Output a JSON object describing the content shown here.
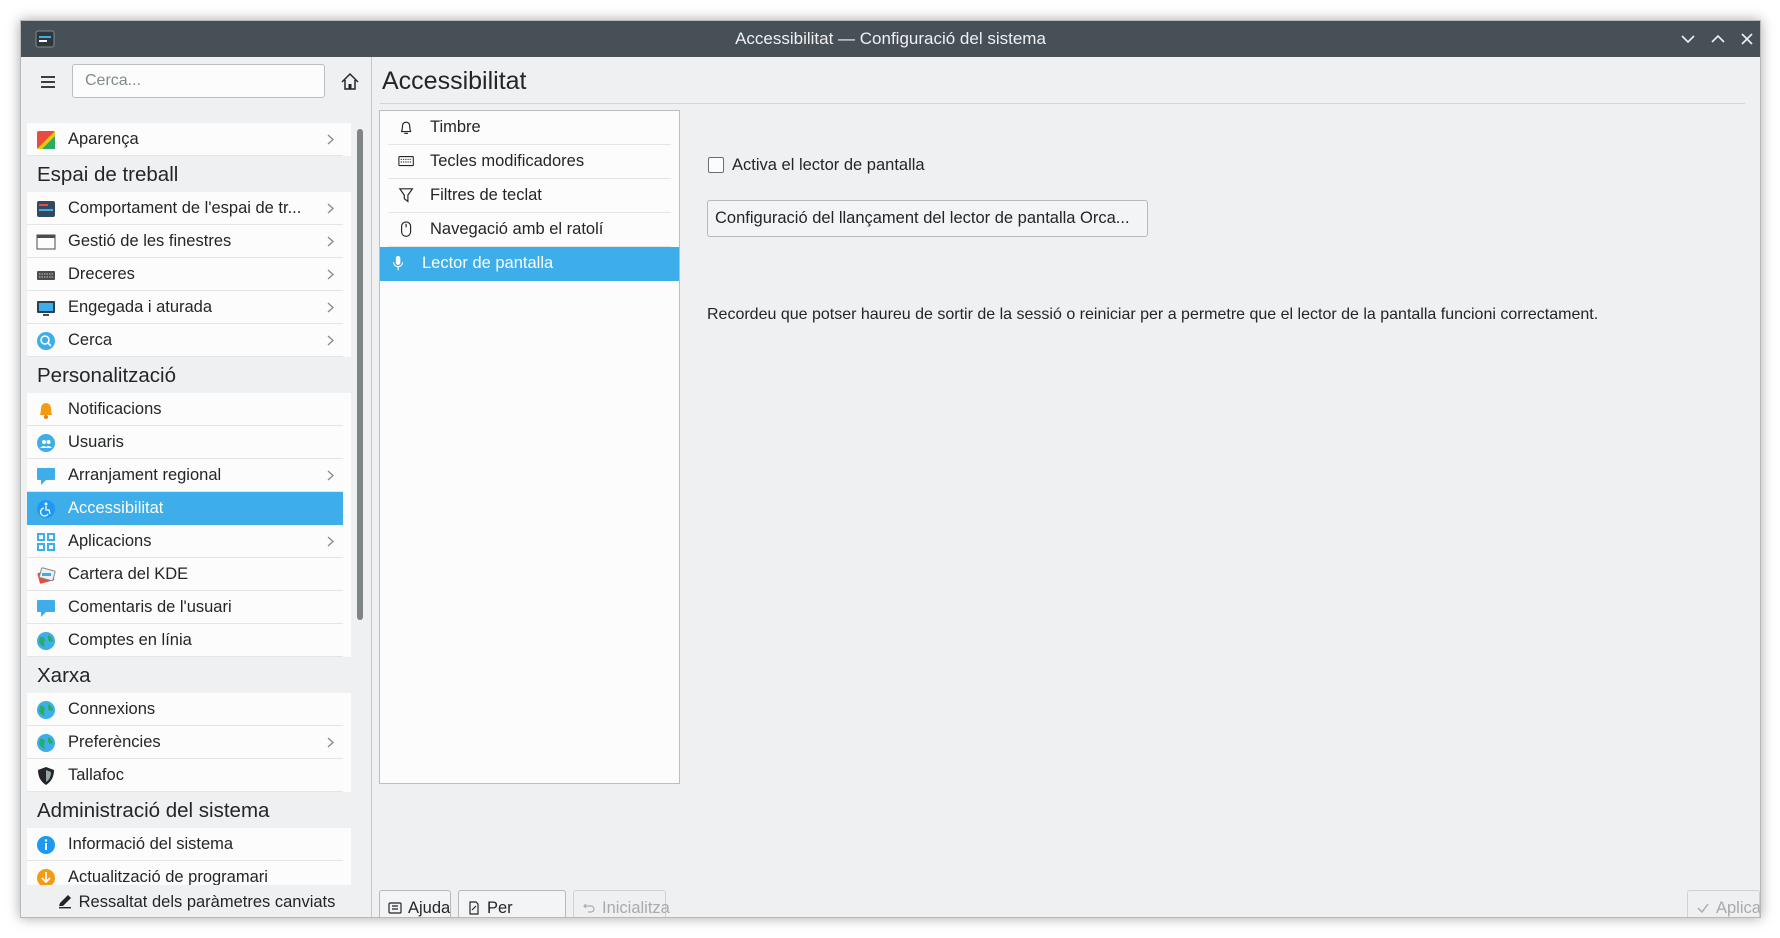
{
  "window": {
    "title": "Accessibilitat — Configuració del sistema",
    "controls": [
      "minimize",
      "maximize",
      "close"
    ]
  },
  "sidebar": {
    "search_placeholder": "Cerca...",
    "sections": [
      {
        "type": "item",
        "label": "Aparença",
        "icon": "appearance-icon",
        "chevron": true
      },
      {
        "type": "category",
        "label": "Espai de treball"
      },
      {
        "type": "item",
        "label": "Comportament de l'espai de tr...",
        "icon": "workspace-icon",
        "chevron": true
      },
      {
        "type": "item",
        "label": "Gestió de les finestres",
        "icon": "window-icon",
        "chevron": true
      },
      {
        "type": "item",
        "label": "Dreceres",
        "icon": "keyboard-icon",
        "chevron": true
      },
      {
        "type": "item",
        "label": "Engegada i aturada",
        "icon": "monitor-icon",
        "chevron": true
      },
      {
        "type": "item",
        "label": "Cerca",
        "icon": "search-icon",
        "chevron": true
      },
      {
        "type": "category",
        "label": "Personalització"
      },
      {
        "type": "item",
        "label": "Notificacions",
        "icon": "bell-icon",
        "chevron": false
      },
      {
        "type": "item",
        "label": "Usuaris",
        "icon": "users-icon",
        "chevron": false
      },
      {
        "type": "item",
        "label": "Arranjament regional",
        "icon": "chat-icon",
        "chevron": true
      },
      {
        "type": "item",
        "label": "Accessibilitat",
        "icon": "accessibility-icon",
        "chevron": false,
        "selected": true
      },
      {
        "type": "item",
        "label": "Aplicacions",
        "icon": "apps-icon",
        "chevron": true
      },
      {
        "type": "item",
        "label": "Cartera del KDE",
        "icon": "wallet-icon",
        "chevron": false
      },
      {
        "type": "item",
        "label": "Comentaris de l'usuari",
        "icon": "chat-icon",
        "chevron": false
      },
      {
        "type": "item",
        "label": "Comptes en línia",
        "icon": "globe-icon",
        "chevron": false
      },
      {
        "type": "category",
        "label": "Xarxa"
      },
      {
        "type": "item",
        "label": "Connexions",
        "icon": "globe-icon",
        "chevron": false
      },
      {
        "type": "item",
        "label": "Preferències",
        "icon": "globe-icon",
        "chevron": true
      },
      {
        "type": "item",
        "label": "Tallafoc",
        "icon": "shield-icon",
        "chevron": false
      },
      {
        "type": "category",
        "label": "Administració del sistema"
      },
      {
        "type": "item",
        "label": "Informació del sistema",
        "icon": "info-icon",
        "chevron": false
      },
      {
        "type": "item",
        "label": "Actualització de programari",
        "icon": "update-icon",
        "chevron": false
      }
    ],
    "footer_label": "Ressaltat dels paràmetres canviats"
  },
  "main": {
    "title": "Accessibilitat",
    "subpages": [
      {
        "label": "Timbre",
        "icon": "bell-outline-icon"
      },
      {
        "label": "Tecles modificadores",
        "icon": "keyboard-outline-icon"
      },
      {
        "label": "Filtres de teclat",
        "icon": "filter-icon"
      },
      {
        "label": "Navegació amb el ratolí",
        "icon": "mouse-icon"
      },
      {
        "label": "Lector de pantalla",
        "icon": "microphone-icon",
        "selected": true
      }
    ],
    "screen_reader": {
      "checkbox_label": "Activa el lector de pantalla",
      "checked": false,
      "orca_button": "Configuració del llançament del lector de pantalla Orca...",
      "note": "Recordeu que potser haureu de sortir de la sessió o reiniciar per a permetre que el lector de la pantalla funcioni correctament."
    },
    "buttons": {
      "help": "Ajuda",
      "defaults": "Per omissió",
      "reset": "Inicialitza",
      "apply": "Aplica"
    }
  },
  "colors": {
    "accent": "#3daee9",
    "titlebar": "#475057",
    "window_bg": "#eff0f1",
    "view_bg": "#fcfcfc"
  }
}
